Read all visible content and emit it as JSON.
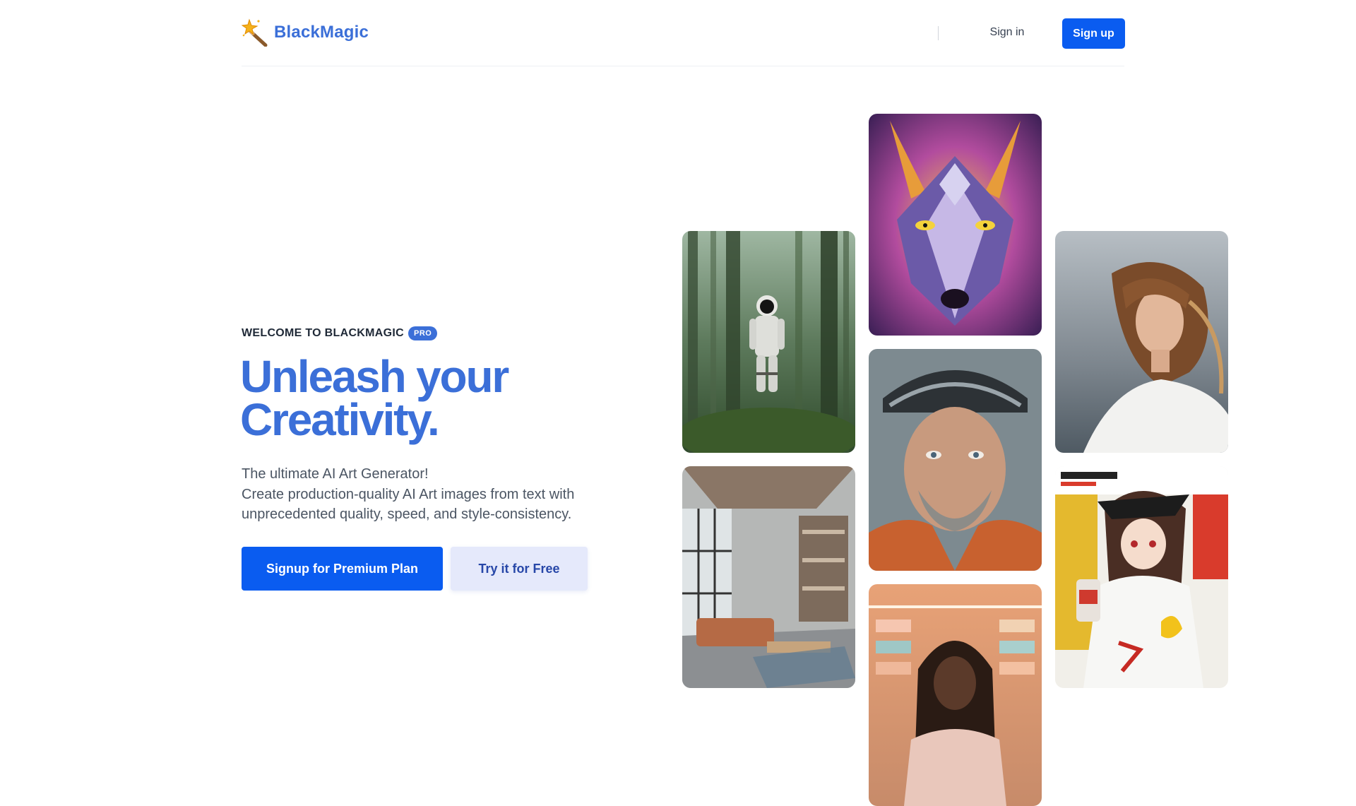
{
  "brand": {
    "name": "BlackMagic",
    "logo_icon": "magic-wand-icon",
    "accent": "#3b6fd8"
  },
  "nav": {
    "signin_label": "Sign in",
    "signup_label": "Sign up",
    "primary_color": "#0a5cf0"
  },
  "hero": {
    "eyebrow": "WELCOME TO BLACKMAGIC",
    "badge": "PRO",
    "headline_line1": "Unleash your",
    "headline_line2": "Creativity.",
    "desc_line1": "The ultimate AI Art Generator!",
    "desc_line2": "Create production-quality AI Art images from text with",
    "desc_line3": "unprecedented quality, speed, and style-consistency.",
    "cta_primary": "Signup for Premium Plan",
    "cta_secondary": "Try it for Free"
  },
  "gallery": [
    {
      "subject": "astronaut in forest"
    },
    {
      "subject": "psychedelic wolf"
    },
    {
      "subject": "woman by the sea"
    },
    {
      "subject": "modern living room"
    },
    {
      "subject": "man in helmet"
    },
    {
      "subject": "anime girl poster"
    },
    {
      "subject": "woman in store"
    }
  ]
}
